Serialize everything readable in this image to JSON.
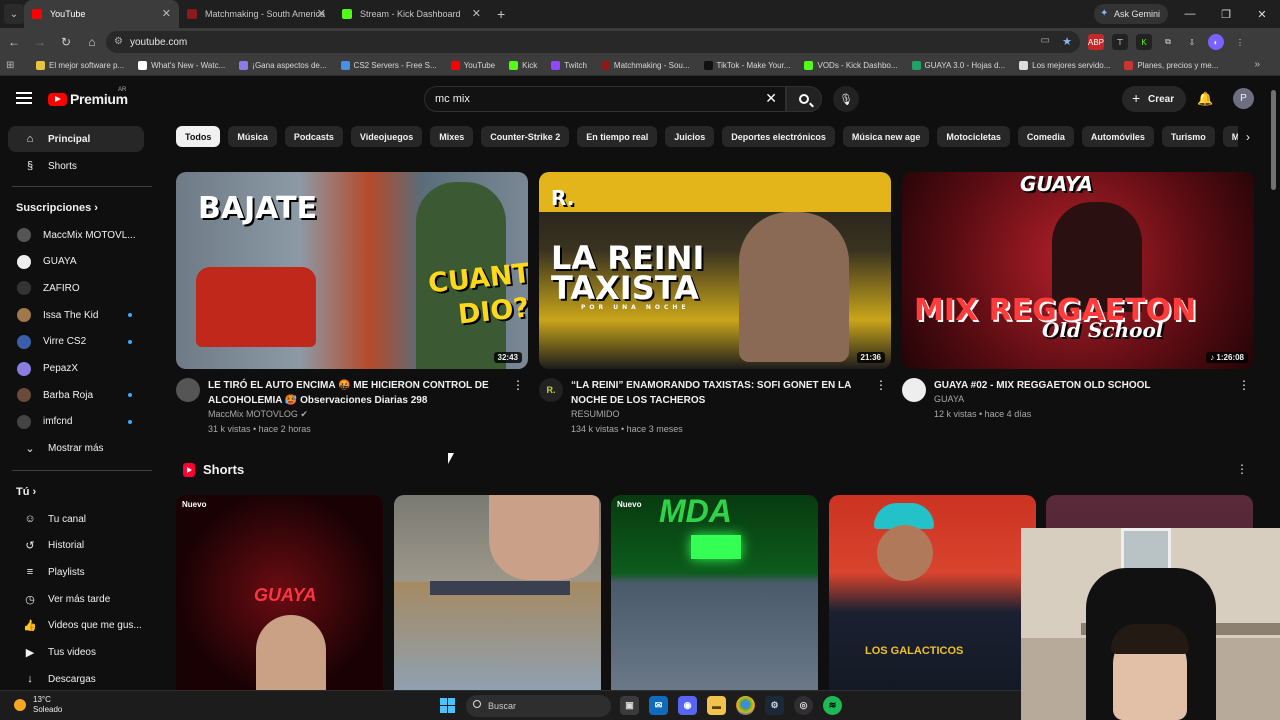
{
  "browser": {
    "tabs": [
      {
        "title": "YouTube",
        "color": "#ff0000",
        "active": true
      },
      {
        "title": "Matchmaking - South America",
        "color": "#8b1a1a",
        "active": false
      },
      {
        "title": "Stream - Kick Dashboard",
        "color": "#53fc18",
        "active": false
      }
    ],
    "ask_gemini": "Ask Gemini",
    "url": "youtube.com",
    "bookmarks": [
      {
        "label": "El mejor software p...",
        "color": "#e8c33c"
      },
      {
        "label": "What's New - Watc...",
        "color": "#ffffff"
      },
      {
        "label": "¡Gana aspectos de...",
        "color": "#8c7ae6"
      },
      {
        "label": "CS2 Servers - Free S...",
        "color": "#4a90e2"
      },
      {
        "label": "YouTube",
        "color": "#ff0000"
      },
      {
        "label": "Kick",
        "color": "#53fc18"
      },
      {
        "label": "Twitch",
        "color": "#9146ff"
      },
      {
        "label": "Matchmaking - Sou...",
        "color": "#8b1a1a"
      },
      {
        "label": "TikTok - Make Your...",
        "color": "#111111"
      },
      {
        "label": "VODs - Kick Dashbo...",
        "color": "#53fc18"
      },
      {
        "label": "GUAYA 3.0 - Hojas d...",
        "color": "#1fa463"
      },
      {
        "label": "Los mejores servido...",
        "color": "#dddddd"
      },
      {
        "label": "Planes, precios y me...",
        "color": "#cc3333"
      }
    ]
  },
  "masthead": {
    "logo": "Premium",
    "country": "AR",
    "search_query": "mc mix",
    "create_label": "Crear",
    "avatar_letter": "P"
  },
  "sidebar": {
    "main": [
      {
        "label": "Principal",
        "icon": "home-icon",
        "glyph": "⌂",
        "active": true
      },
      {
        "label": "Shorts",
        "icon": "shorts-icon",
        "glyph": "§",
        "active": false
      }
    ],
    "subs_heading": "Suscripciones",
    "subscriptions": [
      {
        "label": "MaccMix MOTOVL...",
        "color": "#555555",
        "new": false
      },
      {
        "label": "GUAYA",
        "color": "#eeeeee",
        "new": false
      },
      {
        "label": "ZAFIRO",
        "color": "#333333",
        "new": false
      },
      {
        "label": "Issa The Kid",
        "color": "#a0784a",
        "new": true
      },
      {
        "label": "Virre CS2",
        "color": "#3a5fa8",
        "new": true
      },
      {
        "label": "PepazX",
        "color": "#8a7de0",
        "new": false
      },
      {
        "label": "Barba Roja",
        "color": "#6b4a3a",
        "new": true
      },
      {
        "label": "imfcnd",
        "color": "#444444",
        "new": true
      }
    ],
    "show_more": "Mostrar más",
    "you_heading": "Tú",
    "you_items": [
      {
        "label": "Tu canal",
        "icon": "user-icon",
        "glyph": "☺"
      },
      {
        "label": "Historial",
        "icon": "history-icon",
        "glyph": "↺"
      },
      {
        "label": "Playlists",
        "icon": "playlist-icon",
        "glyph": "≡"
      },
      {
        "label": "Ver más tarde",
        "icon": "clock-icon",
        "glyph": "◷"
      },
      {
        "label": "Videos que me gus...",
        "icon": "thumbs-up-icon",
        "glyph": "👍"
      },
      {
        "label": "Tus videos",
        "icon": "video-icon",
        "glyph": "▶"
      },
      {
        "label": "Descargas",
        "icon": "download-icon",
        "glyph": "↓"
      }
    ]
  },
  "chips": [
    "Todos",
    "Música",
    "Podcasts",
    "Videojuegos",
    "Mixes",
    "Counter-Strike 2",
    "En tiempo real",
    "Juicios",
    "Deportes electrónicos",
    "Música new age",
    "Motocicletas",
    "Comedia",
    "Automóviles",
    "Turismo",
    "Música elect"
  ],
  "videos": [
    {
      "title": "LE TIRÓ EL AUTO ENCIMA 🤬 ME HICIERON CONTROL DE ALCOHOLEMIA 🥵 Observaciones Diarias 298",
      "channel": "MaccMix MOTOVLOG ✔",
      "meta": "31 k vistas • hace 2 horas",
      "duration": "32:43",
      "thumb_text": [
        "BAJATE",
        "CUANTO",
        "DIO?"
      ],
      "channel_color": "#555555"
    },
    {
      "title": "“LA REINI” ENAMORANDO TAXISTAS: SOFI GONET EN LA NOCHE DE LOS TACHEROS",
      "channel": "RESUMIDO",
      "meta": "134 k vistas • hace 3 meses",
      "duration": "21:36",
      "thumb_text": [
        "R.",
        "LA REINI",
        "TAXISTA",
        "POR UNA NOCHE"
      ],
      "channel_color": "#222222"
    },
    {
      "title": "GUAYA #02 - MIX REGGAETON OLD SCHOOL",
      "channel": "GUAYA",
      "meta": "12 k vistas • hace 4 días",
      "duration": "♪ 1:26:08",
      "thumb_text": [
        "GUAYA",
        "MIX REGGAETON",
        "Old School"
      ],
      "channel_color": "#eeeeee"
    }
  ],
  "shorts": {
    "heading": "Shorts",
    "items": [
      {
        "badge": "Nuevo",
        "overlay": "GUAYA"
      },
      {
        "badge": "",
        "overlay": ""
      },
      {
        "badge": "Nuevo",
        "overlay": "MDA"
      },
      {
        "badge": "",
        "overlay": "LOS GALACTICOS"
      },
      {
        "badge": "",
        "overlay": ""
      }
    ]
  },
  "taskbar": {
    "temp": "13°C",
    "condition": "Soleado",
    "search": "Buscar"
  }
}
